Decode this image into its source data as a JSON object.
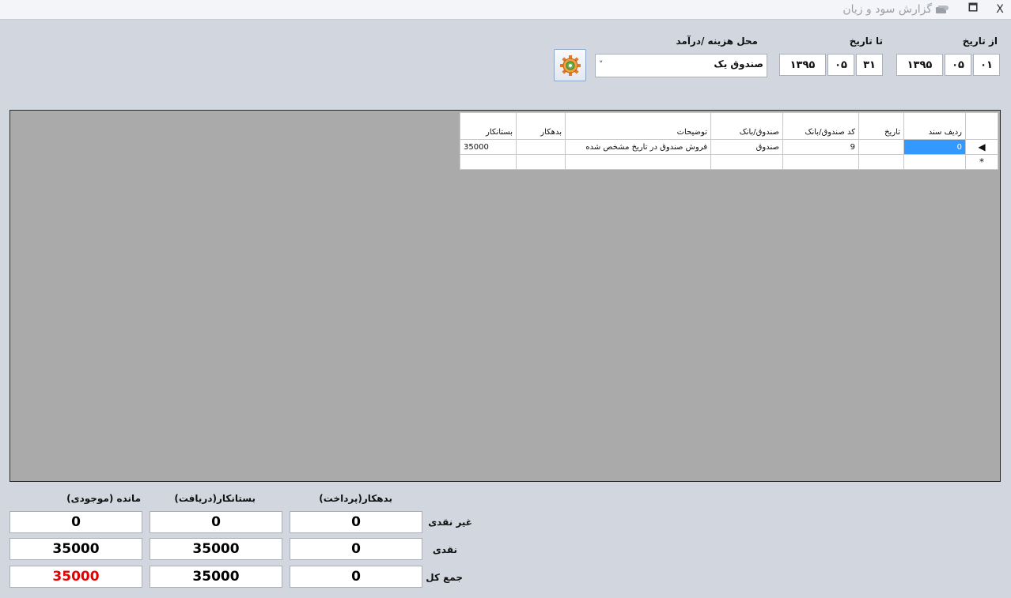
{
  "window": {
    "title": "گزارش سود و زیان",
    "restore_glyph": "🗖",
    "close_glyph": "X"
  },
  "filters": {
    "from_date_label": "از تاریخ",
    "to_date_label": "تا تاریخ",
    "location_label": "محل هزینه /درآمد",
    "from_date": {
      "day": "۰۱",
      "month": "۰۵",
      "year": "۱۳۹۵"
    },
    "to_date": {
      "day": "۳۱",
      "month": "۰۵",
      "year": "۱۳۹۵"
    },
    "location_value": "صندوق یک",
    "dropdown_arrow": "˅"
  },
  "grid": {
    "columns": [
      "ردیف سند",
      "تاریخ",
      "کد صندوق/بانک",
      "صندوق/بانک",
      "توضیحات",
      "بدهکار",
      "بستانکار"
    ],
    "rows": [
      {
        "marker": "◀",
        "radif": "0",
        "tarikh": "",
        "kod": "9",
        "sandogh": "صندوق",
        "tozihat": "فروش صندوق در تاریخ مشخص شده",
        "bedehkar": "",
        "bestankar": "35000"
      }
    ],
    "new_row_marker": "*"
  },
  "summary": {
    "col_debit": "بدهکار(پرداخت)",
    "col_credit": "بستانکار(دریافت)",
    "col_balance": "مانده (موجودی)",
    "row_noncash": "غیر نقدی",
    "row_cash": "نقدی",
    "row_total": "جمع کل",
    "noncash": {
      "debit": "0",
      "credit": "0",
      "balance": "0"
    },
    "cash": {
      "debit": "0",
      "credit": "35000",
      "balance": "35000"
    },
    "total": {
      "debit": "0",
      "credit": "35000",
      "balance": "35000"
    },
    "balance_total_color": "#e60000"
  }
}
